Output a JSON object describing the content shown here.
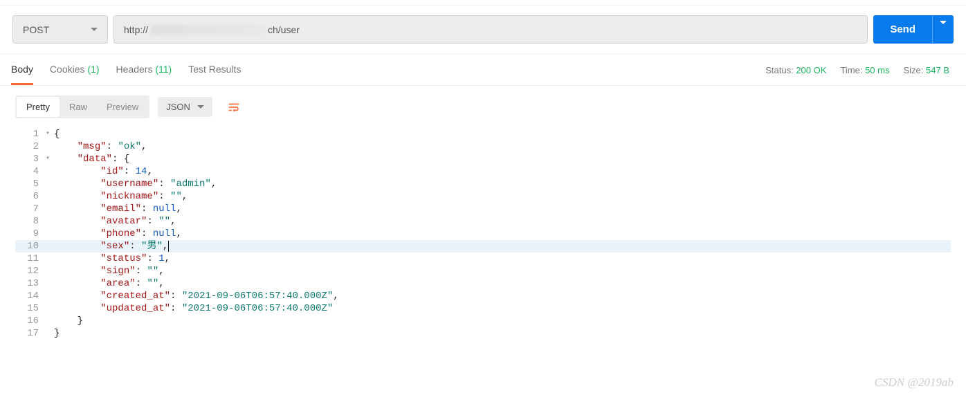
{
  "request": {
    "method": "POST",
    "url_prefix": "http://",
    "url_suffix": "ch/user",
    "send_label": "Send"
  },
  "tabs": {
    "body": "Body",
    "cookies": "Cookies",
    "cookies_count": "(1)",
    "headers": "Headers",
    "headers_count": "(11)",
    "test_results": "Test Results"
  },
  "status": {
    "status_label": "Status:",
    "status_value": "200 OK",
    "time_label": "Time:",
    "time_value": "50 ms",
    "size_label": "Size:",
    "size_value": "547 B"
  },
  "view": {
    "pretty": "Pretty",
    "raw": "Raw",
    "preview": "Preview",
    "format": "JSON"
  },
  "json_response": {
    "msg": "ok",
    "data": {
      "id": 14,
      "username": "admin",
      "nickname": "",
      "email": null,
      "avatar": "",
      "phone": null,
      "sex": "男",
      "status": 1,
      "sign": "",
      "area": "",
      "created_at": "2021-09-06T06:57:40.000Z",
      "updated_at": "2021-09-06T06:57:40.000Z"
    }
  },
  "lines": {
    "n1": "1",
    "n2": "2",
    "n3": "3",
    "n4": "4",
    "n5": "5",
    "n6": "6",
    "n7": "7",
    "n8": "8",
    "n9": "9",
    "n10": "10",
    "n11": "11",
    "n12": "12",
    "n13": "13",
    "n14": "14",
    "n15": "15",
    "n16": "16",
    "n17": "17"
  },
  "watermark": "CSDN @2019ab"
}
